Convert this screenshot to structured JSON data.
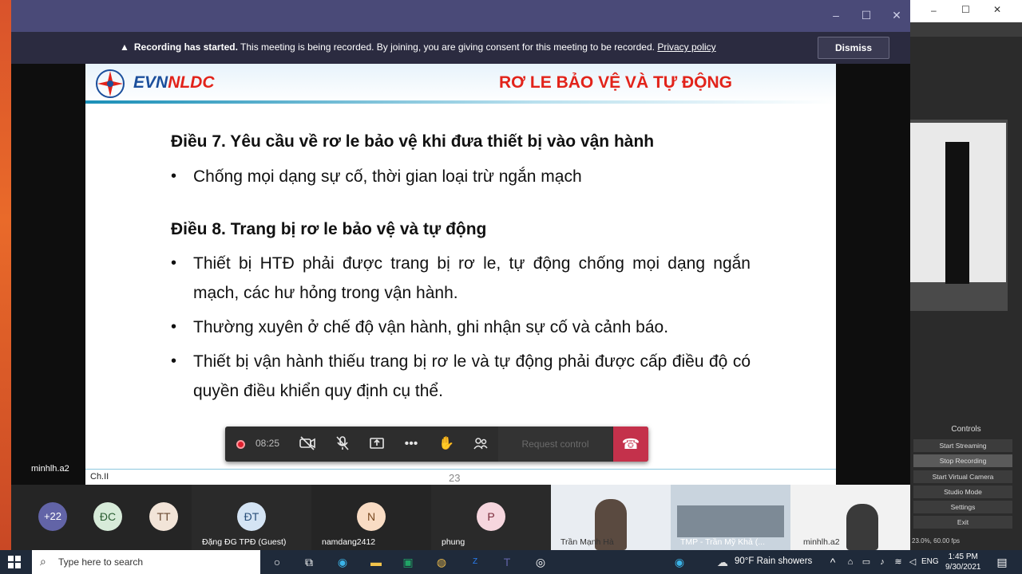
{
  "banner": {
    "bold": "Recording has started.",
    "text": " This meeting is being recorded. By joining, you are giving consent for this meeting to be recorded. ",
    "link": "Privacy policy",
    "dismiss": "Dismiss"
  },
  "slide": {
    "brand_a": "EVN",
    "brand_b": "NLDC",
    "title": "RƠ LE BẢO VỆ VÀ TỰ ĐỘNG",
    "heading1": "Điều 7. Yêu cầu về rơ le bảo vệ khi đưa thiết bị vào vận hành",
    "bullets1": [
      "Chống mọi dạng sự cố, thời gian loại trừ ngắn mạch"
    ],
    "heading2": "Điều 8. Trang bị rơ le bảo vệ và tự động",
    "bullets2": [
      "Thiết bị HTĐ phải được trang bị rơ le, tự động chống mọi dạng ngắn mạch, các hư hỏng trong vận hành.",
      "Thường xuyên ở chế độ vận hành, ghi nhận sự cố và cảnh báo.",
      "Thiết bị vận hành thiếu trang bị rơ le và tự động phải được cấp điều độ có quyền điều khiển quy định cụ thể."
    ],
    "bullet_char": "•",
    "footer_left": "Ch.II",
    "page": "23"
  },
  "self_name": "minhlh.a2",
  "controls": {
    "timer": "08:25",
    "request_control": "Request control"
  },
  "participants": {
    "more": "+22",
    "avatars": [
      {
        "initials": "ĐC",
        "color": "#d7ebd9"
      },
      {
        "initials": "TT",
        "color": "#f2e4d8"
      },
      {
        "initials": "ĐT",
        "color": "#d4e4f4",
        "name": "Đặng ĐG TPĐ (Guest)"
      },
      {
        "initials": "N",
        "color": "#f9dcc4",
        "name": "namdang2412"
      },
      {
        "initials": "P",
        "color": "#f6d6de",
        "name": "phung"
      }
    ],
    "video_names": [
      "Trần Mạnh Hà",
      "TMP - Trần Mỹ Khả (...",
      "minhlh.a2"
    ]
  },
  "obs": {
    "controls_title": "Controls",
    "buttons": [
      "Start Streaming",
      "Stop Recording",
      "Start Virtual Camera",
      "Studio Mode",
      "Settings",
      "Exit"
    ],
    "status": "23.0%, 60.00 fps"
  },
  "taskbar": {
    "search": "Type here to search",
    "weather": "90°F  Rain showers",
    "lang": "ENG",
    "time": "1:45 PM",
    "date": "9/30/2021"
  }
}
